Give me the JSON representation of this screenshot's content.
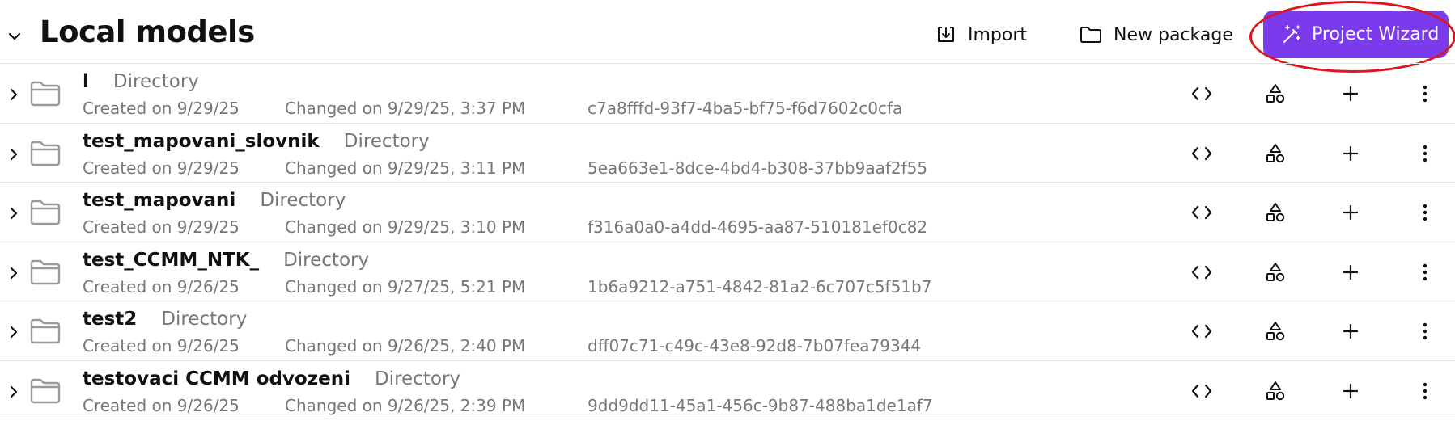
{
  "header": {
    "title": "Local models",
    "import_label": "Import",
    "new_package_label": "New package",
    "project_wizard_label": "Project Wizard"
  },
  "colors": {
    "accent": "#7c3aed",
    "highlight_ring": "#e0141c",
    "muted_text": "#777777",
    "divider": "#e6e6e6"
  },
  "icons": {
    "collapse": "chevron-down-icon",
    "import": "download-icon",
    "new_package": "folder-icon",
    "wizard": "magic-wand-icon",
    "row_expand": "chevron-right-icon",
    "row_folder": "folder-icon",
    "code": "code-icon",
    "shapes": "shapes-icon",
    "add": "plus-icon",
    "more": "more-vertical-icon"
  },
  "rows": [
    {
      "name": "l",
      "type": "Directory",
      "created": "Created on 9/29/25",
      "changed": "Changed on 9/29/25, 3:37 PM",
      "id": "c7a8fffd-93f7-4ba5-bf75-f6d7602c0cfa"
    },
    {
      "name": "test_mapovani_slovnik",
      "type": "Directory",
      "created": "Created on 9/29/25",
      "changed": "Changed on 9/29/25, 3:11 PM",
      "id": "5ea663e1-8dce-4bd4-b308-37bb9aaf2f55"
    },
    {
      "name": "test_mapovani",
      "type": "Directory",
      "created": "Created on 9/29/25",
      "changed": "Changed on 9/29/25, 3:10 PM",
      "id": "f316a0a0-a4dd-4695-aa87-510181ef0c82"
    },
    {
      "name": "test_CCMM_NTK_",
      "type": "Directory",
      "created": "Created on 9/26/25",
      "changed": "Changed on 9/27/25, 5:21 PM",
      "id": "1b6a9212-a751-4842-81a2-6c707c5f51b7"
    },
    {
      "name": "test2",
      "type": "Directory",
      "created": "Created on 9/26/25",
      "changed": "Changed on 9/26/25, 2:40 PM",
      "id": "dff07c71-c49c-43e8-92d8-7b07fea79344"
    },
    {
      "name": "testovaci CCMM odvozeni",
      "type": "Directory",
      "created": "Created on 9/26/25",
      "changed": "Changed on 9/26/25, 2:39 PM",
      "id": "9dd9dd11-45a1-456c-9b87-488ba1de1af7"
    }
  ]
}
